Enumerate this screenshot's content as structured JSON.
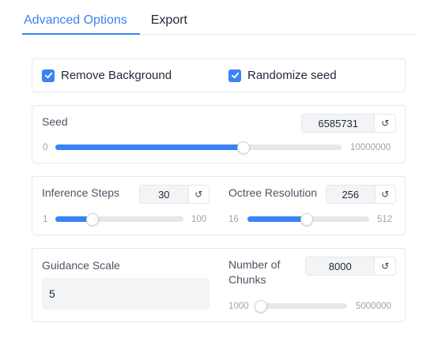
{
  "tabs": [
    {
      "label": "Advanced Options",
      "active": true
    },
    {
      "label": "Export",
      "active": false
    }
  ],
  "checkboxes": {
    "remove_background": {
      "label": "Remove Background",
      "checked": true
    },
    "randomize_seed": {
      "label": "Randomize seed",
      "checked": true
    }
  },
  "seed": {
    "label": "Seed",
    "value": "6585731",
    "min": "0",
    "max": "10000000",
    "fraction": 0.6586
  },
  "inference_steps": {
    "label": "Inference Steps",
    "value": "30",
    "min": "1",
    "max": "100",
    "fraction": 0.293
  },
  "octree_resolution": {
    "label": "Octree Resolution",
    "value": "256",
    "min": "16",
    "max": "512",
    "fraction": 0.484
  },
  "guidance_scale": {
    "label": "Guidance Scale",
    "value": "5"
  },
  "num_chunks": {
    "label_line1": "Number of",
    "label_line2": "Chunks",
    "value": "8000",
    "min": "1000",
    "max": "5000000",
    "fraction": 0.0014
  },
  "icons": {
    "reset": "reset-icon",
    "check": "check-icon"
  },
  "colors": {
    "accent": "#3b82f6",
    "track": "#e5e7eb",
    "input_bg": "#f3f4f6",
    "border": "#e5e7eb"
  }
}
